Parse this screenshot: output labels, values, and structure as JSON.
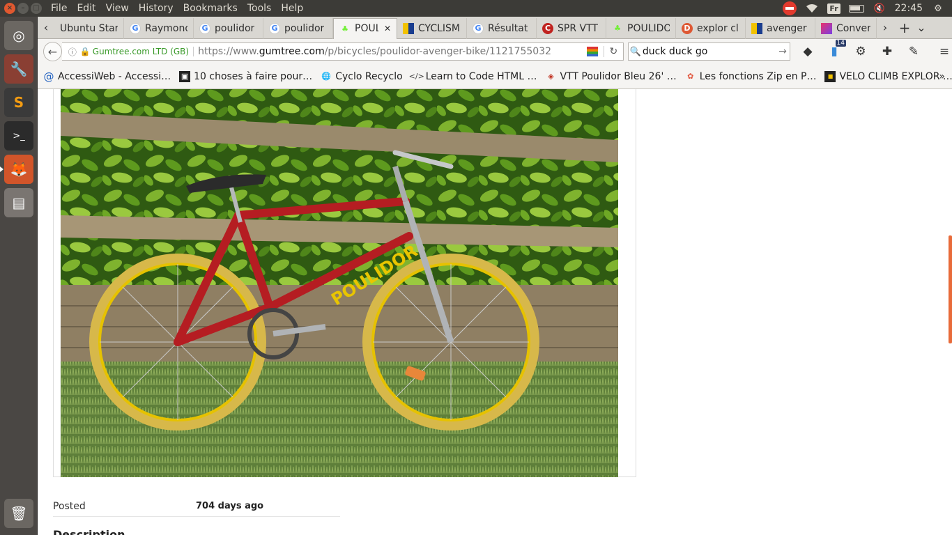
{
  "system": {
    "menu": [
      "File",
      "Edit",
      "View",
      "History",
      "Bookmarks",
      "Tools",
      "Help"
    ],
    "keyboard_layout": "Fr",
    "clock": "22:45"
  },
  "tabs": [
    {
      "label": "Ubuntu Star",
      "icon": "ubuntu-icon"
    },
    {
      "label": "Raymond",
      "icon": "google-icon"
    },
    {
      "label": "poulidor",
      "icon": "google-icon"
    },
    {
      "label": "poulidor",
      "icon": "google-icon"
    },
    {
      "label": "POULI",
      "icon": "gumtree-icon",
      "active": true
    },
    {
      "label": "CYCLISM",
      "icon": "site-icon"
    },
    {
      "label": "Résultat",
      "icon": "google-icon"
    },
    {
      "label": "SPR VTT",
      "icon": "site-icon"
    },
    {
      "label": "POULIDO",
      "icon": "gumtree-icon"
    },
    {
      "label": "explor cl",
      "icon": "duckduckgo-icon"
    },
    {
      "label": "avenger",
      "icon": "site-icon"
    },
    {
      "label": "Convert",
      "icon": "site-icon"
    }
  ],
  "address": {
    "org": "Gumtree.com LTD (GB)",
    "url_prefix": "https://www.",
    "url_domain": "gumtree.com",
    "url_path": "/p/bicycles/poulidor-avenger-bike/1121755032"
  },
  "search": {
    "value": "duck duck go"
  },
  "notifications_badge": "14",
  "bookmarks": [
    {
      "label": "AccessiWeb - Accessi…",
      "icon": "at-icon"
    },
    {
      "label": "10 choses à faire pour…",
      "icon": "site-icon"
    },
    {
      "label": "Cyclo Recyclo",
      "icon": "globe-icon"
    },
    {
      "label": "Learn to Code HTML …",
      "icon": "code-icon"
    },
    {
      "label": "VTT Poulidor Bleu 26' …",
      "icon": "cube-icon"
    },
    {
      "label": "Les fonctions Zip en P…",
      "icon": "site-icon"
    },
    {
      "label": "VELO CLIMB EXPLOR …",
      "icon": "site-icon"
    }
  ],
  "listing": {
    "posted_label": "Posted",
    "posted_value": "704 days ago",
    "description_heading": "Description",
    "bike_brand": "POULIDOR"
  }
}
